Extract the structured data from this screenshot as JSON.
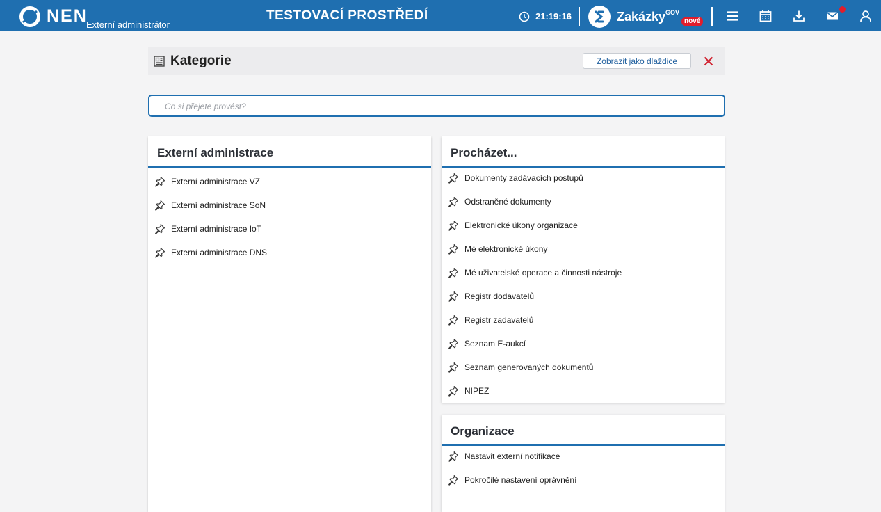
{
  "header": {
    "logo": "NEN",
    "subtitle": "Externí administrátor",
    "env_title": "TESTOVACÍ PROSTŘEDÍ",
    "time": "21:19:16",
    "zakazky": {
      "label": "Zakázky",
      "sup": "GOV",
      "badge": "nové"
    },
    "icons": [
      "menu-icon",
      "calendar-icon",
      "download-icon",
      "mail-icon",
      "user-icon"
    ],
    "accent": "#1f6fb0",
    "badge_color": "#e11d2c"
  },
  "category": {
    "title": "Kategorie",
    "tile_button": "Zobrazit jako dlaždice"
  },
  "search": {
    "placeholder": "Co si přejete provést?",
    "value": ""
  },
  "panels": {
    "ext_admin": {
      "title": "Externí administrace",
      "items": [
        "Externí administrace VZ",
        "Externí administrace SoN",
        "Externí administrace IoT",
        "Externí administrace DNS"
      ]
    },
    "browse": {
      "title": "Procházet...",
      "items": [
        "Dokumenty zadávacích postupů",
        "Odstraněné dokumenty",
        "Elektronické úkony organizace",
        "Mé elektronické úkony",
        "Mé uživatelské operace a činnosti nástroje",
        "Registr dodavatelů",
        "Registr zadavatelů",
        "Seznam E-aukcí",
        "Seznam generovaných dokumentů",
        "NIPEZ"
      ]
    },
    "org": {
      "title": "Organizace",
      "items": [
        "Nastavit externí notifikace",
        "Pokročilé nastavení oprávnění"
      ]
    }
  }
}
